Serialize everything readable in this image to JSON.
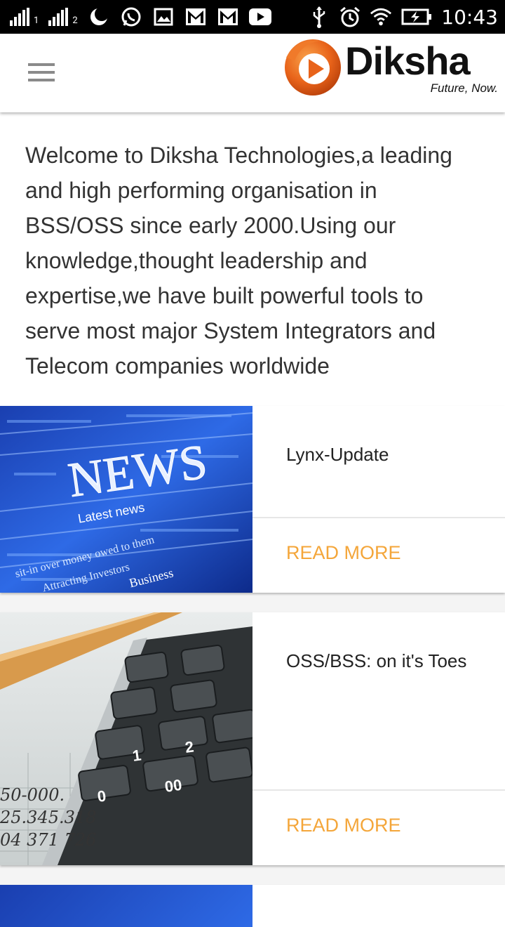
{
  "status_bar": {
    "sim1_label": "1",
    "sim2_label": "2",
    "icons": [
      "signal-icon",
      "signal-icon",
      "night-mode-icon",
      "whatsapp-icon",
      "gallery-icon",
      "gmail-icon",
      "gmail-icon",
      "youtube-icon",
      "usb-icon",
      "alarm-icon",
      "wifi-icon",
      "battery-charging-icon"
    ],
    "time": "10:43"
  },
  "app_bar": {
    "menu_icon": "hamburger-menu-icon",
    "logo": {
      "name": "Diksha",
      "tagline": "Future, Now."
    }
  },
  "intro_text": "Welcome to Diksha Technologies,a leading and high performing organisation in BSS/OSS since early 2000.Using our knowledge,thought leadership and expertise,we have built powerful tools to serve most major System Integrators and Telecom companies worldwide",
  "articles": [
    {
      "title": "Lynx-Update",
      "read_more": "READ MORE",
      "image": "news-image"
    },
    {
      "title": "OSS/BSS: on it's Toes",
      "read_more": "READ MORE",
      "image": "calculator-image"
    }
  ],
  "colors": {
    "accent": "#f4a63a",
    "logo_orange": "#e8631a",
    "status_bar": "#000000"
  }
}
